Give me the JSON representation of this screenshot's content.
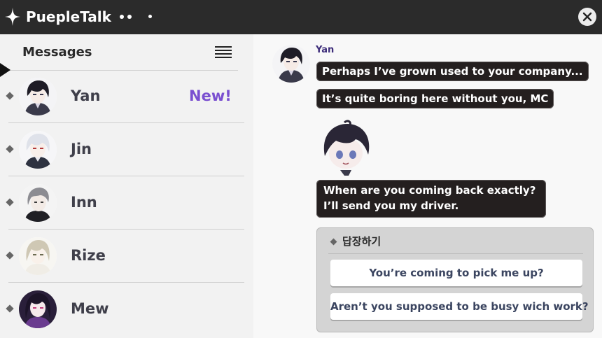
{
  "app": {
    "title": "PuepleTalk",
    "close_icon": "close-icon",
    "star_icon": "sparkle-star-icon"
  },
  "sidebar": {
    "title": "Messages",
    "menu_icon": "hamburger-menu-icon",
    "contacts": [
      {
        "name": "Yan",
        "badge": "New!",
        "avatar": "avatar-yan"
      },
      {
        "name": "Jin",
        "badge": "",
        "avatar": "avatar-jin"
      },
      {
        "name": "Inn",
        "badge": "",
        "avatar": "avatar-inn"
      },
      {
        "name": "Rize",
        "badge": "",
        "avatar": "avatar-rize"
      },
      {
        "name": "Mew",
        "badge": "",
        "avatar": "avatar-mew"
      }
    ],
    "selected_index": 0
  },
  "chat": {
    "sender": "Yan",
    "messages": [
      {
        "text": "Perhaps I’ve grown used to your company..."
      },
      {
        "text": "It’s quite boring here without you, MC"
      },
      {
        "type": "sticker",
        "icon": "chibi-yan-sticker"
      },
      {
        "line1": "When are you coming back exactly?",
        "line2": "I’ll send you my driver."
      }
    ],
    "reply": {
      "header": "답장하기",
      "options": [
        "You’re coming to pick me up?",
        "Aren’t you supposed to be busy wich work?"
      ]
    }
  },
  "colors": {
    "titlebar": "#2b2b2b",
    "badge": "#7a4fd0",
    "bubble": "#241f1f",
    "sender": "#3d2d7a"
  }
}
